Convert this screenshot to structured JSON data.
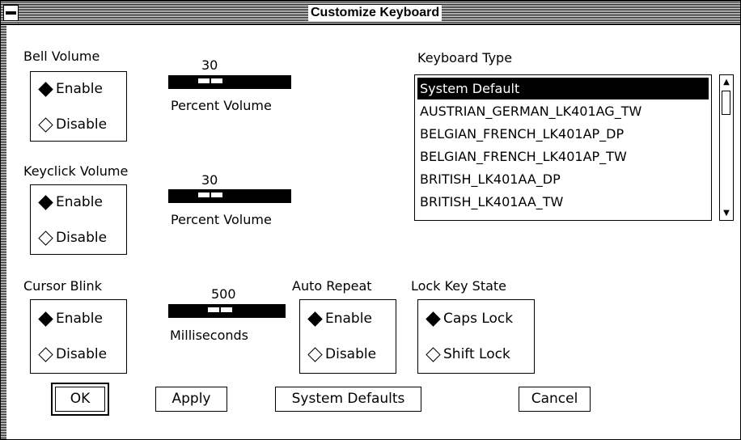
{
  "window": {
    "title": "Customize Keyboard"
  },
  "bell_volume": {
    "label": "Bell Volume",
    "enable": "Enable",
    "disable": "Disable",
    "selected": "enable",
    "value": "30",
    "unit": "Percent Volume",
    "level": 0.3
  },
  "keyclick_volume": {
    "label": "Keyclick Volume",
    "enable": "Enable",
    "disable": "Disable",
    "selected": "enable",
    "value": "30",
    "unit": "Percent Volume",
    "level": 0.3
  },
  "cursor_blink": {
    "label": "Cursor Blink",
    "enable": "Enable",
    "disable": "Disable",
    "selected": "enable",
    "value": "500",
    "unit": "Milliseconds"
  },
  "auto_repeat": {
    "label": "Auto Repeat",
    "enable": "Enable",
    "disable": "Disable",
    "selected": "enable"
  },
  "lock_key_state": {
    "label": "Lock Key State",
    "caps": "Caps Lock",
    "shift": "Shift Lock",
    "selected": "caps"
  },
  "keyboard_type": {
    "label": "Keyboard Type",
    "items": [
      "System Default",
      "AUSTRIAN_GERMAN_LK401AG_TW",
      "BELGIAN_FRENCH_LK401AP_DP",
      "BELGIAN_FRENCH_LK401AP_TW",
      "BRITISH_LK401AA_DP",
      "BRITISH_LK401AA_TW"
    ],
    "selected": "System Default"
  },
  "buttons": {
    "ok": "OK",
    "apply": "Apply",
    "system_defaults": "System Defaults",
    "cancel": "Cancel"
  }
}
